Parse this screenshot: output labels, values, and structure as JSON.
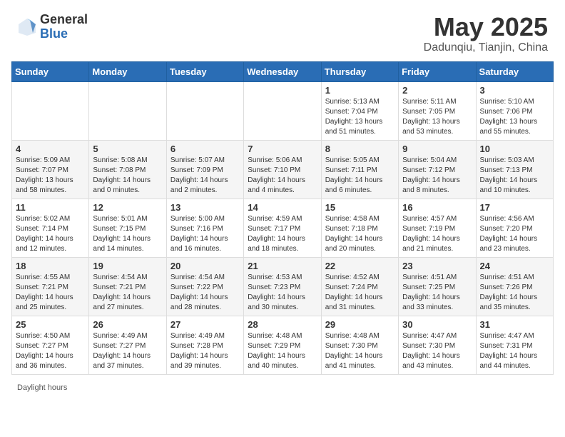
{
  "header": {
    "logo_general": "General",
    "logo_blue": "Blue",
    "month_title": "May 2025",
    "subtitle": "Dadunqiu, Tianjin, China"
  },
  "footer": {
    "daylight_label": "Daylight hours"
  },
  "weekdays": [
    "Sunday",
    "Monday",
    "Tuesday",
    "Wednesday",
    "Thursday",
    "Friday",
    "Saturday"
  ],
  "weeks": [
    [
      {
        "day": "",
        "sunrise": "",
        "sunset": "",
        "daylight": ""
      },
      {
        "day": "",
        "sunrise": "",
        "sunset": "",
        "daylight": ""
      },
      {
        "day": "",
        "sunrise": "",
        "sunset": "",
        "daylight": ""
      },
      {
        "day": "",
        "sunrise": "",
        "sunset": "",
        "daylight": ""
      },
      {
        "day": "1",
        "sunrise": "Sunrise: 5:13 AM",
        "sunset": "Sunset: 7:04 PM",
        "daylight": "Daylight: 13 hours and 51 minutes."
      },
      {
        "day": "2",
        "sunrise": "Sunrise: 5:11 AM",
        "sunset": "Sunset: 7:05 PM",
        "daylight": "Daylight: 13 hours and 53 minutes."
      },
      {
        "day": "3",
        "sunrise": "Sunrise: 5:10 AM",
        "sunset": "Sunset: 7:06 PM",
        "daylight": "Daylight: 13 hours and 55 minutes."
      }
    ],
    [
      {
        "day": "4",
        "sunrise": "Sunrise: 5:09 AM",
        "sunset": "Sunset: 7:07 PM",
        "daylight": "Daylight: 13 hours and 58 minutes."
      },
      {
        "day": "5",
        "sunrise": "Sunrise: 5:08 AM",
        "sunset": "Sunset: 7:08 PM",
        "daylight": "Daylight: 14 hours and 0 minutes."
      },
      {
        "day": "6",
        "sunrise": "Sunrise: 5:07 AM",
        "sunset": "Sunset: 7:09 PM",
        "daylight": "Daylight: 14 hours and 2 minutes."
      },
      {
        "day": "7",
        "sunrise": "Sunrise: 5:06 AM",
        "sunset": "Sunset: 7:10 PM",
        "daylight": "Daylight: 14 hours and 4 minutes."
      },
      {
        "day": "8",
        "sunrise": "Sunrise: 5:05 AM",
        "sunset": "Sunset: 7:11 PM",
        "daylight": "Daylight: 14 hours and 6 minutes."
      },
      {
        "day": "9",
        "sunrise": "Sunrise: 5:04 AM",
        "sunset": "Sunset: 7:12 PM",
        "daylight": "Daylight: 14 hours and 8 minutes."
      },
      {
        "day": "10",
        "sunrise": "Sunrise: 5:03 AM",
        "sunset": "Sunset: 7:13 PM",
        "daylight": "Daylight: 14 hours and 10 minutes."
      }
    ],
    [
      {
        "day": "11",
        "sunrise": "Sunrise: 5:02 AM",
        "sunset": "Sunset: 7:14 PM",
        "daylight": "Daylight: 14 hours and 12 minutes."
      },
      {
        "day": "12",
        "sunrise": "Sunrise: 5:01 AM",
        "sunset": "Sunset: 7:15 PM",
        "daylight": "Daylight: 14 hours and 14 minutes."
      },
      {
        "day": "13",
        "sunrise": "Sunrise: 5:00 AM",
        "sunset": "Sunset: 7:16 PM",
        "daylight": "Daylight: 14 hours and 16 minutes."
      },
      {
        "day": "14",
        "sunrise": "Sunrise: 4:59 AM",
        "sunset": "Sunset: 7:17 PM",
        "daylight": "Daylight: 14 hours and 18 minutes."
      },
      {
        "day": "15",
        "sunrise": "Sunrise: 4:58 AM",
        "sunset": "Sunset: 7:18 PM",
        "daylight": "Daylight: 14 hours and 20 minutes."
      },
      {
        "day": "16",
        "sunrise": "Sunrise: 4:57 AM",
        "sunset": "Sunset: 7:19 PM",
        "daylight": "Daylight: 14 hours and 21 minutes."
      },
      {
        "day": "17",
        "sunrise": "Sunrise: 4:56 AM",
        "sunset": "Sunset: 7:20 PM",
        "daylight": "Daylight: 14 hours and 23 minutes."
      }
    ],
    [
      {
        "day": "18",
        "sunrise": "Sunrise: 4:55 AM",
        "sunset": "Sunset: 7:21 PM",
        "daylight": "Daylight: 14 hours and 25 minutes."
      },
      {
        "day": "19",
        "sunrise": "Sunrise: 4:54 AM",
        "sunset": "Sunset: 7:21 PM",
        "daylight": "Daylight: 14 hours and 27 minutes."
      },
      {
        "day": "20",
        "sunrise": "Sunrise: 4:54 AM",
        "sunset": "Sunset: 7:22 PM",
        "daylight": "Daylight: 14 hours and 28 minutes."
      },
      {
        "day": "21",
        "sunrise": "Sunrise: 4:53 AM",
        "sunset": "Sunset: 7:23 PM",
        "daylight": "Daylight: 14 hours and 30 minutes."
      },
      {
        "day": "22",
        "sunrise": "Sunrise: 4:52 AM",
        "sunset": "Sunset: 7:24 PM",
        "daylight": "Daylight: 14 hours and 31 minutes."
      },
      {
        "day": "23",
        "sunrise": "Sunrise: 4:51 AM",
        "sunset": "Sunset: 7:25 PM",
        "daylight": "Daylight: 14 hours and 33 minutes."
      },
      {
        "day": "24",
        "sunrise": "Sunrise: 4:51 AM",
        "sunset": "Sunset: 7:26 PM",
        "daylight": "Daylight: 14 hours and 35 minutes."
      }
    ],
    [
      {
        "day": "25",
        "sunrise": "Sunrise: 4:50 AM",
        "sunset": "Sunset: 7:27 PM",
        "daylight": "Daylight: 14 hours and 36 minutes."
      },
      {
        "day": "26",
        "sunrise": "Sunrise: 4:49 AM",
        "sunset": "Sunset: 7:27 PM",
        "daylight": "Daylight: 14 hours and 37 minutes."
      },
      {
        "day": "27",
        "sunrise": "Sunrise: 4:49 AM",
        "sunset": "Sunset: 7:28 PM",
        "daylight": "Daylight: 14 hours and 39 minutes."
      },
      {
        "day": "28",
        "sunrise": "Sunrise: 4:48 AM",
        "sunset": "Sunset: 7:29 PM",
        "daylight": "Daylight: 14 hours and 40 minutes."
      },
      {
        "day": "29",
        "sunrise": "Sunrise: 4:48 AM",
        "sunset": "Sunset: 7:30 PM",
        "daylight": "Daylight: 14 hours and 41 minutes."
      },
      {
        "day": "30",
        "sunrise": "Sunrise: 4:47 AM",
        "sunset": "Sunset: 7:30 PM",
        "daylight": "Daylight: 14 hours and 43 minutes."
      },
      {
        "day": "31",
        "sunrise": "Sunrise: 4:47 AM",
        "sunset": "Sunset: 7:31 PM",
        "daylight": "Daylight: 14 hours and 44 minutes."
      }
    ]
  ]
}
